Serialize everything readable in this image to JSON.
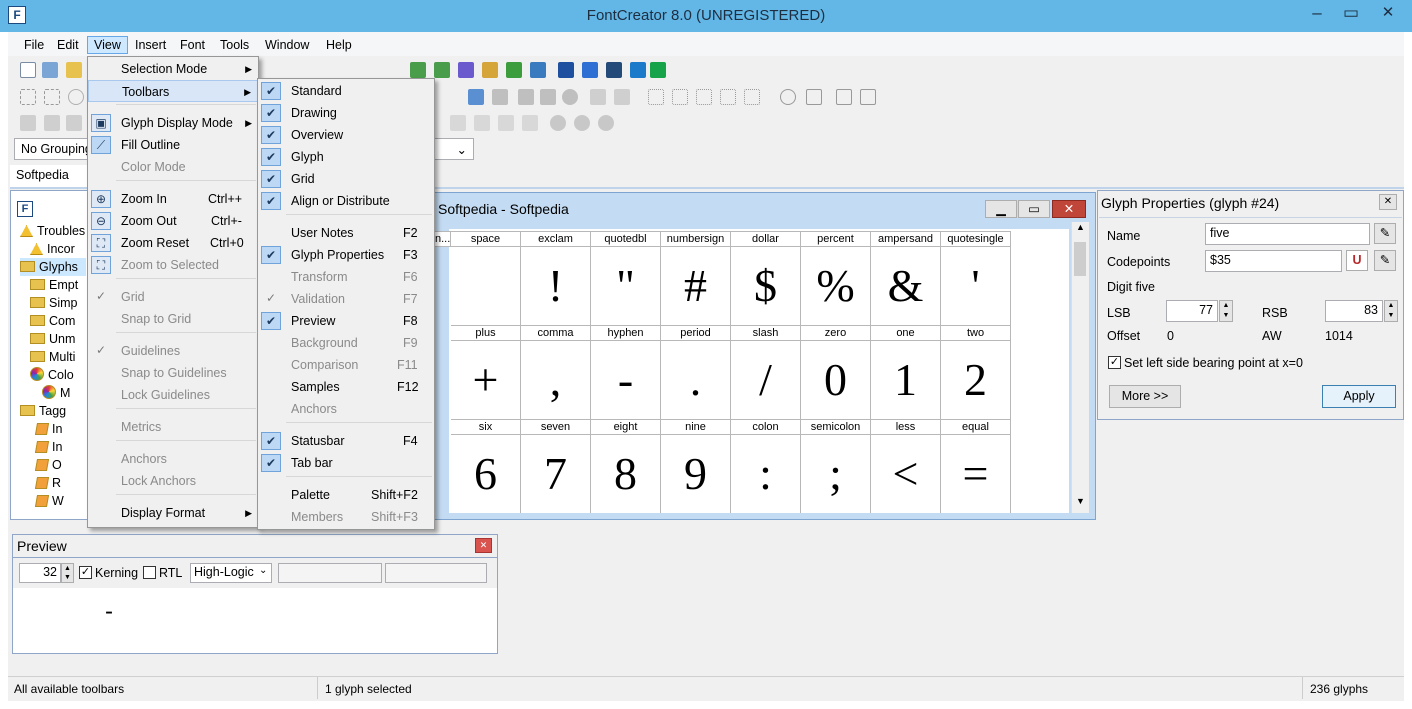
{
  "window": {
    "title": "FontCreator 8.0 (UNREGISTERED)",
    "minimize": "‒",
    "restore": "▭",
    "close": "✕"
  },
  "menubar": [
    "File",
    "Edit",
    "View",
    "Insert",
    "Font",
    "Tools",
    "Window",
    "Help"
  ],
  "toolbar": {
    "grouping": "No Grouping",
    "font_selector": "Softpedia"
  },
  "view_menu": {
    "items": [
      {
        "label": "Selection Mode",
        "submenu": true
      },
      {
        "label": "Toolbars",
        "submenu": true
      },
      {
        "label": "Glyph Display Mode",
        "submenu": true
      },
      {
        "label": "Fill Outline"
      },
      {
        "label": "Color Mode"
      },
      {
        "label": "Zoom In",
        "shortcut": "Ctrl++"
      },
      {
        "label": "Zoom Out",
        "shortcut": "Ctrl+-"
      },
      {
        "label": "Zoom Reset",
        "shortcut": "Ctrl+0"
      },
      {
        "label": "Zoom to Selected"
      },
      {
        "label": "Grid"
      },
      {
        "label": "Snap to Grid"
      },
      {
        "label": "Guidelines"
      },
      {
        "label": "Snap to Guidelines"
      },
      {
        "label": "Lock Guidelines"
      },
      {
        "label": "Metrics"
      },
      {
        "label": "Anchors"
      },
      {
        "label": "Lock Anchors"
      },
      {
        "label": "Display Format",
        "submenu": true
      }
    ]
  },
  "toolbars_submenu": {
    "items": [
      {
        "label": "Standard",
        "checked": true
      },
      {
        "label": "Drawing",
        "checked": true
      },
      {
        "label": "Overview",
        "checked": true
      },
      {
        "label": "Glyph",
        "checked": true
      },
      {
        "label": "Grid",
        "checked": true
      },
      {
        "label": "Align or Distribute",
        "checked": true
      },
      {
        "label": "User Notes",
        "shortcut": "F2"
      },
      {
        "label": "Glyph Properties",
        "shortcut": "F3",
        "checked": true
      },
      {
        "label": "Transform",
        "shortcut": "F6"
      },
      {
        "label": "Validation",
        "shortcut": "F7"
      },
      {
        "label": "Preview",
        "shortcut": "F8",
        "checked": true
      },
      {
        "label": "Background",
        "shortcut": "F9"
      },
      {
        "label": "Comparison",
        "shortcut": "F11"
      },
      {
        "label": "Samples",
        "shortcut": "F12"
      },
      {
        "label": "Anchors"
      },
      {
        "label": "Statusbar",
        "shortcut": "F4",
        "checked": true
      },
      {
        "label": "Tab bar",
        "checked": true
      },
      {
        "label": "Palette",
        "shortcut": "Shift+F2"
      },
      {
        "label": "Members",
        "shortcut": "Shift+F3"
      }
    ]
  },
  "tree": [
    {
      "label": "Troubles",
      "icon": "warning-icon"
    },
    {
      "label": "Incor",
      "icon": "warning-icon"
    },
    {
      "label": "Glyphs",
      "icon": "folder-icon"
    },
    {
      "label": "Empt",
      "icon": "folder-icon"
    },
    {
      "label": "Simp",
      "icon": "folder-icon"
    },
    {
      "label": "Com",
      "icon": "folder-icon"
    },
    {
      "label": "Unm",
      "icon": "folder-icon"
    },
    {
      "label": "Multi",
      "icon": "folder-icon"
    },
    {
      "label": "Colo",
      "icon": "color-icon"
    },
    {
      "label": "M",
      "icon": "color-icon"
    },
    {
      "label": "Tagg",
      "icon": "folder-icon"
    },
    {
      "label": "In",
      "icon": "tag-icon"
    },
    {
      "label": "In",
      "icon": "tag-icon"
    },
    {
      "label": "O",
      "icon": "tag-icon"
    },
    {
      "label": "R",
      "icon": "tag-icon"
    },
    {
      "label": "W",
      "icon": "tag-icon"
    }
  ],
  "font_window": {
    "title": "Softpedia - Softpedia",
    "partial_header": "n..."
  },
  "glyph_rows": [
    [
      {
        "name": "space",
        "char": ""
      },
      {
        "name": "exclam",
        "char": "!"
      },
      {
        "name": "quotedbl",
        "char": "\""
      },
      {
        "name": "numbersign",
        "char": "#"
      },
      {
        "name": "dollar",
        "char": "$"
      },
      {
        "name": "percent",
        "char": "%"
      },
      {
        "name": "ampersand",
        "char": "&"
      },
      {
        "name": "quotesingle",
        "char": "'"
      }
    ],
    [
      {
        "name": "plus",
        "char": "+"
      },
      {
        "name": "comma",
        "char": ","
      },
      {
        "name": "hyphen",
        "char": "-"
      },
      {
        "name": "period",
        "char": "."
      },
      {
        "name": "slash",
        "char": "/"
      },
      {
        "name": "zero",
        "char": "0"
      },
      {
        "name": "one",
        "char": "1"
      },
      {
        "name": "two",
        "char": "2"
      }
    ],
    [
      {
        "name": "six",
        "char": "6"
      },
      {
        "name": "seven",
        "char": "7"
      },
      {
        "name": "eight",
        "char": "8"
      },
      {
        "name": "nine",
        "char": "9"
      },
      {
        "name": "colon",
        "char": ":"
      },
      {
        "name": "semicolon",
        "char": ";"
      },
      {
        "name": "less",
        "char": "<"
      },
      {
        "name": "equal",
        "char": "="
      }
    ]
  ],
  "glyph_properties": {
    "title": "Glyph Properties (glyph #24)",
    "name_label": "Name",
    "name_value": "five",
    "codepoints_label": "Codepoints",
    "codepoints_value": "$35",
    "description": "Digit five",
    "lsb_label": "LSB",
    "lsb_value": "77",
    "rsb_label": "RSB",
    "rsb_value": "83",
    "offset_label": "Offset",
    "offset_value": "0",
    "aw_label": "AW",
    "aw_value": "1014",
    "checkbox_label": "Set left side bearing point at x=0",
    "more_button": "More >>",
    "apply_button": "Apply"
  },
  "preview": {
    "title": "Preview",
    "size": "32",
    "kerning_label": "Kerning",
    "rtl_label": "RTL",
    "layout_engine": "High-Logic",
    "sample_text": "-"
  },
  "statusbar": {
    "left": "All available toolbars",
    "middle": "1 glyph selected",
    "right": "236 glyphs"
  },
  "watermark": "SOFTPEDIA"
}
